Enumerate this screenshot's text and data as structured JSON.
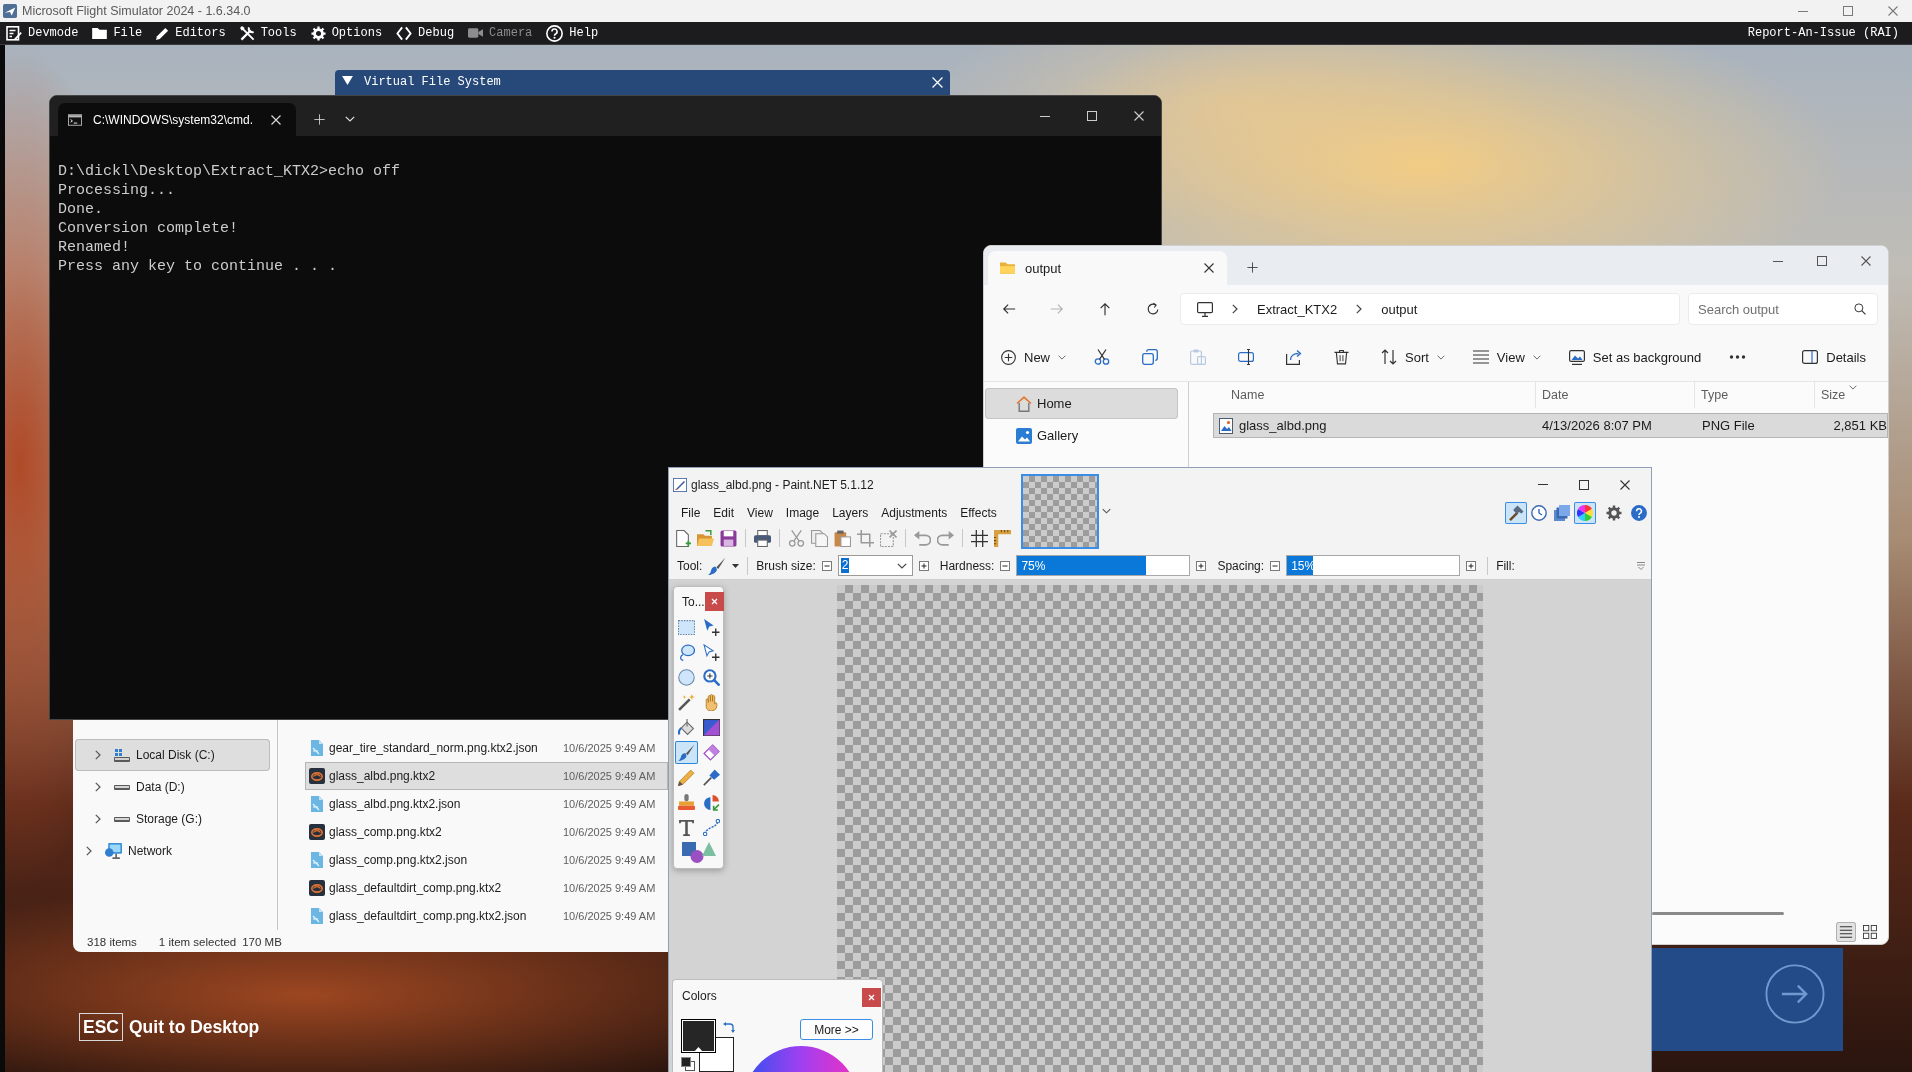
{
  "app_window": {
    "title": "Microsoft Flight Simulator 2024 - 1.6.34.0"
  },
  "dev_menu": {
    "items": [
      {
        "label": "Devmode",
        "kind": "devmode",
        "disabled": false
      },
      {
        "label": "File",
        "kind": "file",
        "disabled": false
      },
      {
        "label": "Editors",
        "kind": "editors",
        "disabled": false
      },
      {
        "label": "Tools",
        "kind": "tools",
        "disabled": false
      },
      {
        "label": "Options",
        "kind": "options",
        "disabled": false
      },
      {
        "label": "Debug",
        "kind": "debug",
        "disabled": false
      },
      {
        "label": "Camera",
        "kind": "camera",
        "disabled": true
      },
      {
        "label": "Help",
        "kind": "help",
        "disabled": false
      }
    ],
    "report_link": "Report-An-Issue (RAI)"
  },
  "virtual_file_system": {
    "title": "Virtual File System",
    "expanded": true
  },
  "terminal": {
    "tab_title": "C:\\WINDOWS\\system32\\cmd.",
    "lines": [
      "D:\\dickl\\Desktop\\Extract_KTX2>echo off",
      "Processing...",
      "Done.",
      "Conversion complete!",
      "Renamed!",
      "Press any key to continue . . ."
    ]
  },
  "explorer_ktx2": {
    "tree": [
      {
        "expanded": true,
        "children": [
          {
            "label": "Local Disk (C:)",
            "kind": "system_drive",
            "expanded": false,
            "selected": true
          },
          {
            "label": "Data (D:)",
            "kind": "drive",
            "expanded": false,
            "selected": false
          },
          {
            "label": "Storage (G:)",
            "kind": "drive",
            "expanded": false,
            "selected": false
          }
        ]
      },
      {
        "label": "Network",
        "kind": "network",
        "expanded": false,
        "selected": false
      }
    ],
    "files": [
      {
        "name": "gear_tire_standard_norm.png.ktx2.json",
        "date": "10/6/2025 9:49 AM",
        "kind": "json",
        "selected": false
      },
      {
        "name": "glass_albd.png.ktx2",
        "date": "10/6/2025 9:49 AM",
        "kind": "ktx2",
        "selected": true
      },
      {
        "name": "glass_albd.png.ktx2.json",
        "date": "10/6/2025 9:49 AM",
        "kind": "json",
        "selected": false
      },
      {
        "name": "glass_comp.png.ktx2",
        "date": "10/6/2025 9:49 AM",
        "kind": "ktx2",
        "selected": false
      },
      {
        "name": "glass_comp.png.ktx2.json",
        "date": "10/6/2025 9:49 AM",
        "kind": "json",
        "selected": false
      },
      {
        "name": "glass_defaultdirt_comp.png.ktx2",
        "date": "10/6/2025 9:49 AM",
        "kind": "ktx2",
        "selected": false
      },
      {
        "name": "glass_defaultdirt_comp.png.ktx2.json",
        "date": "10/6/2025 9:49 AM",
        "kind": "json",
        "selected": false
      }
    ],
    "status": {
      "count": "318 items",
      "selection": "1 item selected",
      "size": "170 MB"
    }
  },
  "explorer_output": {
    "tab": "output",
    "nav": [
      {
        "kind": "back",
        "disabled": false
      },
      {
        "kind": "forward",
        "disabled": true
      },
      {
        "kind": "up",
        "disabled": false
      },
      {
        "kind": "refresh",
        "disabled": false
      }
    ],
    "path": [
      "Extract_KTX2",
      "output"
    ],
    "search": {
      "placeholder": "Search output"
    },
    "commands": [
      {
        "kind": "new",
        "label": "New",
        "menu": true,
        "disabled": false
      },
      {
        "kind": "cut",
        "menu": false,
        "disabled": false
      },
      {
        "kind": "copy",
        "menu": false,
        "disabled": false
      },
      {
        "kind": "paste",
        "menu": false,
        "disabled": true
      },
      {
        "kind": "rename",
        "menu": false,
        "disabled": false
      },
      {
        "kind": "share",
        "menu": false,
        "disabled": false
      },
      {
        "kind": "delete",
        "menu": false,
        "disabled": false
      },
      {
        "kind": "sort",
        "label": "Sort",
        "menu": true,
        "disabled": false
      },
      {
        "kind": "view",
        "label": "View",
        "menu": true,
        "disabled": false
      },
      {
        "kind": "background",
        "label": "Set as background",
        "menu": false,
        "disabled": false
      },
      {
        "kind": "more",
        "menu": false,
        "disabled": false
      }
    ],
    "details_button": "Details",
    "sidebar": [
      {
        "label": "Home",
        "kind": "home",
        "selected": true
      },
      {
        "label": "Gallery",
        "kind": "gallery",
        "selected": false
      }
    ],
    "columns": [
      "Name",
      "Date",
      "Type",
      "Size"
    ],
    "rows": [
      {
        "name": "glass_albd.png",
        "date": "4/13/2026 8:07 PM",
        "type": "PNG File",
        "size": "2,851 KB",
        "selected": true
      }
    ],
    "view_modes": [
      {
        "kind": "details",
        "selected": true
      },
      {
        "kind": "tiles",
        "selected": false
      }
    ]
  },
  "paint": {
    "title": "glass_albd.png - Paint.NET 5.1.12",
    "menu": [
      "File",
      "Edit",
      "View",
      "Image",
      "Layers",
      "Adjustments",
      "Effects"
    ],
    "panels": [
      {
        "kind": "tools",
        "selected": true
      },
      {
        "kind": "history",
        "selected": false
      },
      {
        "kind": "layers",
        "selected": false
      },
      {
        "kind": "colors",
        "selected": true
      }
    ],
    "options": {
      "tool_label": "Tool:",
      "brush_size_label": "Brush size:",
      "brush_size": "2",
      "hardness_label": "Hardness:",
      "hardness": {
        "level": 0.75,
        "reading": "75%"
      },
      "spacing_label": "Spacing:",
      "spacing": {
        "level": 0.15,
        "reading": "15%"
      },
      "fill_label": "Fill:"
    },
    "tools_panel": {
      "title": "To...",
      "tools": [
        {
          "kind": "rectangle",
          "selected": false
        },
        {
          "kind": "move",
          "selected": false
        },
        {
          "kind": "lasso",
          "selected": false
        },
        {
          "kind": "movesel",
          "selected": false
        },
        {
          "kind": "ellipse",
          "selected": false
        },
        {
          "kind": "zoom",
          "selected": false
        },
        {
          "kind": "wand",
          "selected": false
        },
        {
          "kind": "pan",
          "selected": false
        },
        {
          "kind": "bucket",
          "selected": false
        },
        {
          "kind": "gradient",
          "selected": false
        },
        {
          "kind": "brush",
          "selected": true
        },
        {
          "kind": "eraser",
          "selected": false
        },
        {
          "kind": "pencil",
          "selected": false
        },
        {
          "kind": "picker",
          "selected": false
        },
        {
          "kind": "stamp",
          "selected": false
        },
        {
          "kind": "recolor",
          "selected": false
        },
        {
          "kind": "text",
          "selected": false
        },
        {
          "kind": "curve",
          "selected": false
        },
        {
          "kind": "shapes",
          "selected": false
        }
      ]
    },
    "colors_panel": {
      "title": "Colors",
      "more_button": "More >>"
    }
  },
  "sim_overlay": {
    "key": "ESC",
    "label": "Quit to Desktop"
  }
}
